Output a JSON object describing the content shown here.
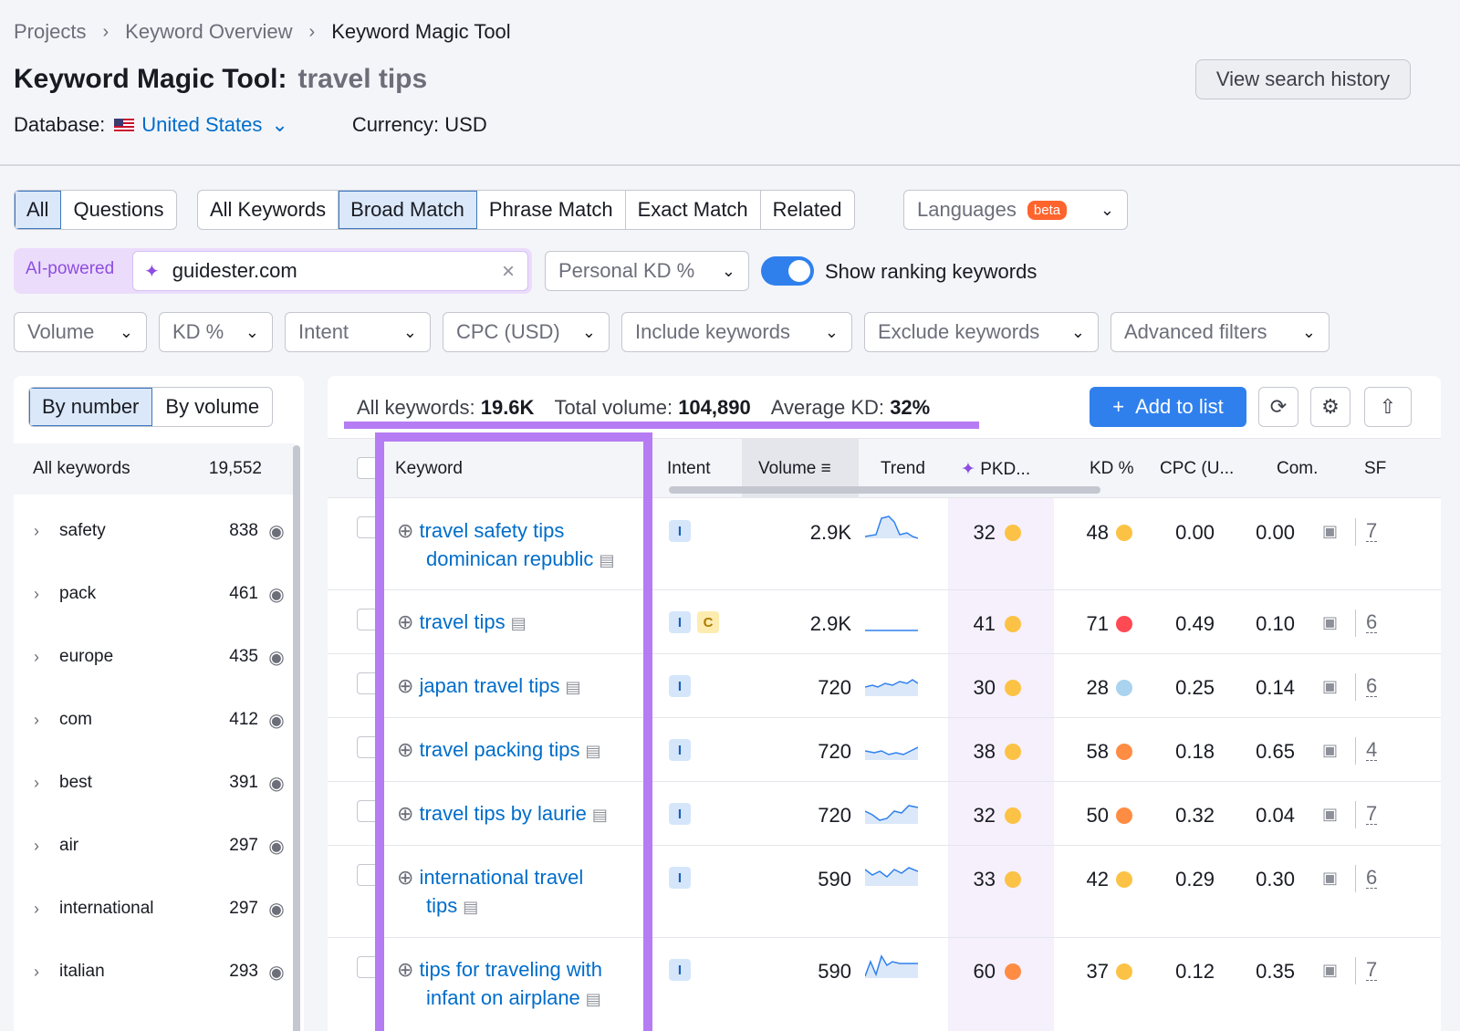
{
  "breadcrumb": [
    "Projects",
    "Keyword Overview",
    "Keyword Magic Tool"
  ],
  "title": {
    "label": "Keyword Magic Tool:",
    "query": "travel tips"
  },
  "database": {
    "label": "Database:",
    "value": "United States"
  },
  "currency": "Currency: USD",
  "history_button": "View search history",
  "tabs_type": [
    "All",
    "Questions"
  ],
  "tabs_match": [
    "All Keywords",
    "Broad Match",
    "Phrase Match",
    "Exact Match",
    "Related"
  ],
  "languages": {
    "label": "Languages",
    "badge": "beta"
  },
  "ai": {
    "label": "AI-powered",
    "domain": "guidester.com"
  },
  "personal_kd": "Personal KD %",
  "toggle_label": "Show ranking keywords",
  "filters": [
    "Volume",
    "KD %",
    "Intent",
    "CPC (USD)",
    "Include keywords",
    "Exclude keywords",
    "Advanced filters"
  ],
  "groups_toggle": [
    "By number",
    "By volume"
  ],
  "all_keywords": {
    "label": "All keywords",
    "count": "19,552"
  },
  "groups": [
    {
      "name": "safety",
      "count": "838"
    },
    {
      "name": "pack",
      "count": "461"
    },
    {
      "name": "europe",
      "count": "435"
    },
    {
      "name": "com",
      "count": "412"
    },
    {
      "name": "best",
      "count": "391"
    },
    {
      "name": "air",
      "count": "297"
    },
    {
      "name": "international",
      "count": "297"
    },
    {
      "name": "italian",
      "count": "293"
    }
  ],
  "summary": {
    "all_label": "All keywords:",
    "all_value": "19.6K",
    "vol_label": "Total volume:",
    "vol_value": "104,890",
    "kd_label": "Average KD:",
    "kd_value": "32%"
  },
  "add_to_list": "Add to list",
  "columns": [
    "Keyword",
    "Intent",
    "Volume",
    "Trend",
    "PKD...",
    "KD %",
    "CPC (U...",
    "Com.",
    "SF"
  ],
  "colors": {
    "yellow": "#fcc245",
    "orange": "#ff8c43",
    "red": "#ff4953",
    "lightblue": "#a9d3ef"
  },
  "rows": [
    {
      "kw1": "travel safety tips",
      "kw2": "dominican republic",
      "intent": [
        "I"
      ],
      "volume": "2.9K",
      "pkd": "32",
      "pkd_color": "#fcc245",
      "kd": "48",
      "kd_color": "#fcc245",
      "cpc": "0.00",
      "com": "0.00",
      "sf": "7"
    },
    {
      "kw1": "travel tips",
      "kw2": "",
      "intent": [
        "I",
        "C"
      ],
      "volume": "2.9K",
      "pkd": "41",
      "pkd_color": "#fcc245",
      "kd": "71",
      "kd_color": "#ff4953",
      "cpc": "0.49",
      "com": "0.10",
      "sf": "6"
    },
    {
      "kw1": "japan travel tips",
      "kw2": "",
      "intent": [
        "I"
      ],
      "volume": "720",
      "pkd": "30",
      "pkd_color": "#fcc245",
      "kd": "28",
      "kd_color": "#a9d3ef",
      "cpc": "0.25",
      "com": "0.14",
      "sf": "6"
    },
    {
      "kw1": "travel packing tips",
      "kw2": "",
      "intent": [
        "I"
      ],
      "volume": "720",
      "pkd": "38",
      "pkd_color": "#fcc245",
      "kd": "58",
      "kd_color": "#ff8c43",
      "cpc": "0.18",
      "com": "0.65",
      "sf": "4"
    },
    {
      "kw1": "travel tips by laurie",
      "kw2": "",
      "intent": [
        "I"
      ],
      "volume": "720",
      "pkd": "32",
      "pkd_color": "#fcc245",
      "kd": "50",
      "kd_color": "#ff8c43",
      "cpc": "0.32",
      "com": "0.04",
      "sf": "7"
    },
    {
      "kw1": "international travel",
      "kw2": "tips",
      "intent": [
        "I"
      ],
      "volume": "590",
      "pkd": "33",
      "pkd_color": "#fcc245",
      "kd": "42",
      "kd_color": "#fcc245",
      "cpc": "0.29",
      "com": "0.30",
      "sf": "6"
    },
    {
      "kw1": "tips for traveling with",
      "kw2": "infant on airplane",
      "intent": [
        "I"
      ],
      "volume": "590",
      "pkd": "60",
      "pkd_color": "#ff8c43",
      "kd": "37",
      "kd_color": "#fcc245",
      "cpc": "0.12",
      "com": "0.35",
      "sf": "7"
    }
  ]
}
